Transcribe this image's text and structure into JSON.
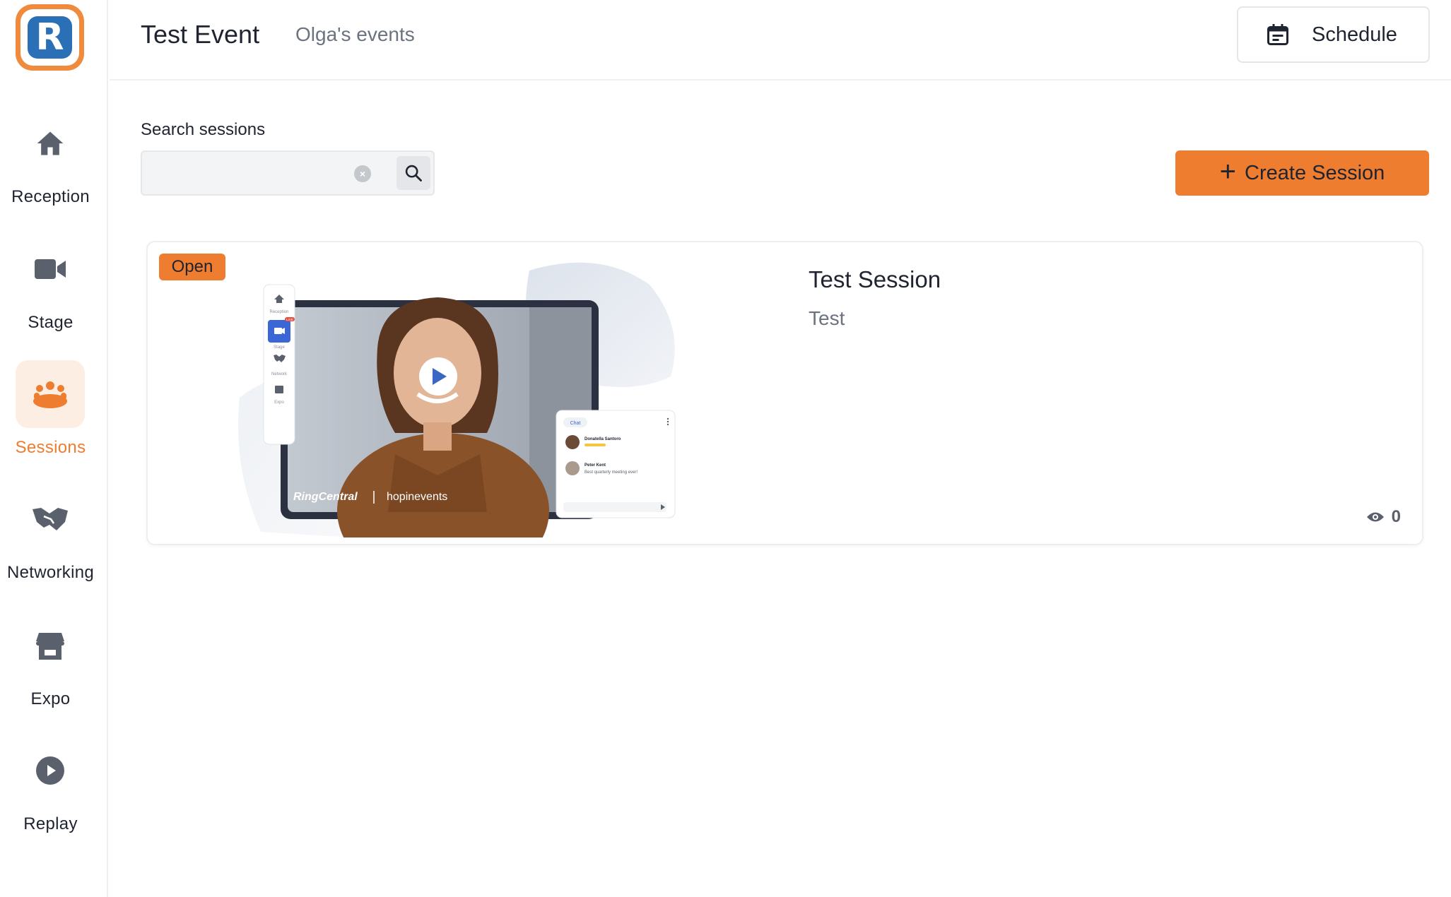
{
  "sidebar": {
    "logo_letter": "R",
    "items": [
      {
        "label": "Reception",
        "icon": "home-icon"
      },
      {
        "label": "Stage",
        "icon": "video-camera-icon"
      },
      {
        "label": "Sessions",
        "icon": "people-group-icon",
        "active": true
      },
      {
        "label": "Networking",
        "icon": "handshake-icon"
      },
      {
        "label": "Expo",
        "icon": "storefront-icon"
      },
      {
        "label": "Replay",
        "icon": "play-circle-icon"
      }
    ]
  },
  "header": {
    "event_title": "Test Event",
    "organizer": "Olga's events",
    "schedule_label": "Schedule"
  },
  "search": {
    "label": "Search sessions",
    "value": "",
    "placeholder": ""
  },
  "actions": {
    "create_session_label": "Create Session"
  },
  "sessions": [
    {
      "status": "Open",
      "title": "Test Session",
      "description": "Test",
      "views": "0",
      "thumbnail": {
        "brand_left": "RingCentral",
        "brand_right": "hopinevents",
        "chat_tab": "Chat",
        "chat_names": [
          "Donatella Santoro",
          "Peter Kent"
        ],
        "chat_message": "Best quarterly meeting ever!",
        "mini_nav": [
          "Reception",
          "Stage",
          "Network",
          "Expo"
        ],
        "live_tag": "LIVE"
      }
    }
  ],
  "colors": {
    "accent": "#ef7d2f",
    "active_bg": "#fdeee3",
    "logo_blue": "#2b6fb6",
    "icon_gray": "#5b616c"
  }
}
